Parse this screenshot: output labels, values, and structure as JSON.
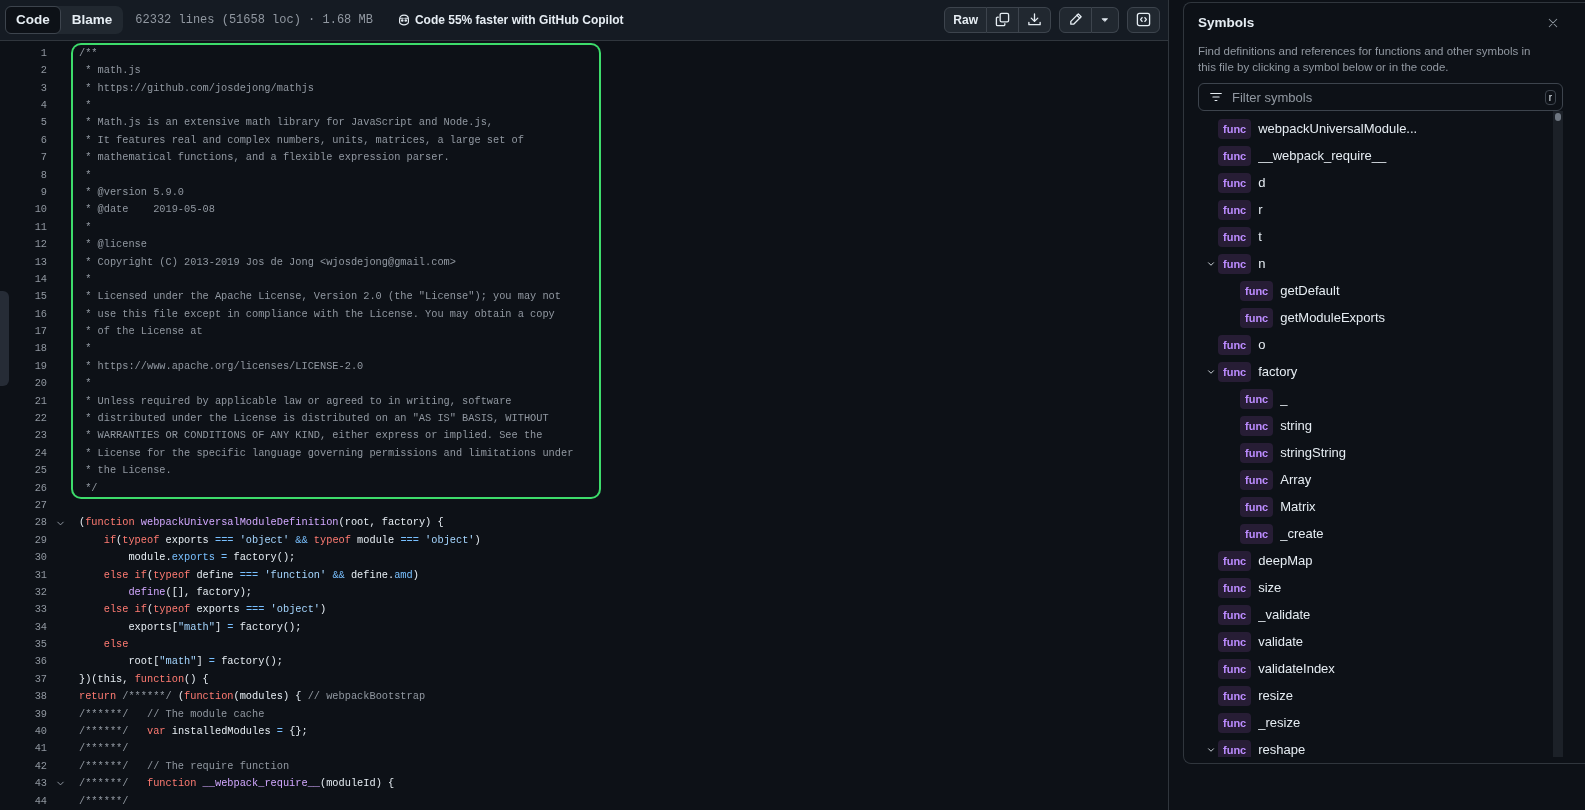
{
  "toolbar": {
    "tabs": [
      {
        "label": "Code",
        "selected": true
      },
      {
        "label": "Blame",
        "selected": false
      }
    ],
    "file_info": "62332 lines (51658 loc) · 1.68 MB",
    "copilot_promo": "Code 55% faster with GitHub Copilot",
    "raw_button": "Raw"
  },
  "code": {
    "blocks": [
      {
        "highlighted": true,
        "lines": [
          {
            "number": "1",
            "foldable": false,
            "tokens": [
              {
                "kind": "comment",
                "text": "/**"
              }
            ]
          },
          {
            "number": "2",
            "foldable": false,
            "tokens": [
              {
                "kind": "comment",
                "text": " * math.js"
              }
            ]
          },
          {
            "number": "3",
            "foldable": false,
            "tokens": [
              {
                "kind": "comment",
                "text": " * https://github.com/josdejong/mathjs"
              }
            ]
          },
          {
            "number": "4",
            "foldable": false,
            "tokens": [
              {
                "kind": "comment",
                "text": " *"
              }
            ]
          },
          {
            "number": "5",
            "foldable": false,
            "tokens": [
              {
                "kind": "comment",
                "text": " * Math.js is an extensive math library for JavaScript and Node.js,"
              }
            ]
          },
          {
            "number": "6",
            "foldable": false,
            "tokens": [
              {
                "kind": "comment",
                "text": " * It features real and complex numbers, units, matrices, a large set of"
              }
            ]
          },
          {
            "number": "7",
            "foldable": false,
            "tokens": [
              {
                "kind": "comment",
                "text": " * mathematical functions, and a flexible expression parser."
              }
            ]
          },
          {
            "number": "8",
            "foldable": false,
            "tokens": [
              {
                "kind": "comment",
                "text": " *"
              }
            ]
          },
          {
            "number": "9",
            "foldable": false,
            "tokens": [
              {
                "kind": "comment",
                "text": " * @version 5.9.0"
              }
            ]
          },
          {
            "number": "10",
            "foldable": false,
            "tokens": [
              {
                "kind": "comment",
                "text": " * @date    2019-05-08"
              }
            ]
          },
          {
            "number": "11",
            "foldable": false,
            "tokens": [
              {
                "kind": "comment",
                "text": " *"
              }
            ]
          },
          {
            "number": "12",
            "foldable": false,
            "tokens": [
              {
                "kind": "comment",
                "text": " * @license"
              }
            ]
          },
          {
            "number": "13",
            "foldable": false,
            "tokens": [
              {
                "kind": "comment",
                "text": " * Copyright (C) 2013-2019 Jos de Jong <wjosdejong@gmail.com>"
              }
            ]
          },
          {
            "number": "14",
            "foldable": false,
            "tokens": [
              {
                "kind": "comment",
                "text": " *"
              }
            ]
          },
          {
            "number": "15",
            "foldable": false,
            "tokens": [
              {
                "kind": "comment",
                "text": " * Licensed under the Apache License, Version 2.0 (the \"License\"); you may not"
              }
            ]
          },
          {
            "number": "16",
            "foldable": false,
            "tokens": [
              {
                "kind": "comment",
                "text": " * use this file except in compliance with the License. You may obtain a copy"
              }
            ]
          },
          {
            "number": "17",
            "foldable": false,
            "tokens": [
              {
                "kind": "comment",
                "text": " * of the License at"
              }
            ]
          },
          {
            "number": "18",
            "foldable": false,
            "tokens": [
              {
                "kind": "comment",
                "text": " *"
              }
            ]
          },
          {
            "number": "19",
            "foldable": false,
            "tokens": [
              {
                "kind": "comment",
                "text": " * https://www.apache.org/licenses/LICENSE-2.0"
              }
            ]
          },
          {
            "number": "20",
            "foldable": false,
            "tokens": [
              {
                "kind": "comment",
                "text": " *"
              }
            ]
          },
          {
            "number": "21",
            "foldable": false,
            "tokens": [
              {
                "kind": "comment",
                "text": " * Unless required by applicable law or agreed to in writing, software"
              }
            ]
          },
          {
            "number": "22",
            "foldable": false,
            "tokens": [
              {
                "kind": "comment",
                "text": " * distributed under the License is distributed on an \"AS IS\" BASIS, WITHOUT"
              }
            ]
          },
          {
            "number": "23",
            "foldable": false,
            "tokens": [
              {
                "kind": "comment",
                "text": " * WARRANTIES OR CONDITIONS OF ANY KIND, either express or implied. See the"
              }
            ]
          },
          {
            "number": "24",
            "foldable": false,
            "tokens": [
              {
                "kind": "comment",
                "text": " * License for the specific language governing permissions and limitations under"
              }
            ]
          },
          {
            "number": "25",
            "foldable": false,
            "tokens": [
              {
                "kind": "comment",
                "text": " * the License."
              }
            ]
          },
          {
            "number": "26",
            "foldable": false,
            "tokens": [
              {
                "kind": "comment",
                "text": " */"
              }
            ]
          }
        ]
      },
      {
        "highlighted": false,
        "lines": [
          {
            "number": "27",
            "foldable": false
          },
          {
            "number": "28",
            "foldable": true,
            "tokens": [
              {
                "kind": "plain",
                "text": "("
              },
              {
                "kind": "keyword",
                "text": "function "
              },
              {
                "kind": "entity",
                "text": "webpackUniversalModuleDefinition"
              },
              {
                "kind": "plain",
                "text": "(root, factory) {"
              }
            ]
          },
          {
            "number": "29",
            "foldable": false,
            "tokens": [
              {
                "kind": "keyword",
                "text": "    if"
              },
              {
                "kind": "plain",
                "text": "("
              },
              {
                "kind": "keyword",
                "text": "typeof"
              },
              {
                "kind": "plain",
                "text": " exports "
              },
              {
                "kind": "constant",
                "text": "=== "
              },
              {
                "kind": "string",
                "text": "'object' "
              },
              {
                "kind": "constant",
                "text": "&& "
              },
              {
                "kind": "keyword",
                "text": "typeof"
              },
              {
                "kind": "plain",
                "text": " module "
              },
              {
                "kind": "constant",
                "text": "=== "
              },
              {
                "kind": "string",
                "text": "'object'"
              },
              {
                "kind": "plain",
                "text": ")"
              }
            ]
          },
          {
            "number": "30",
            "foldable": false,
            "tokens": [
              {
                "kind": "plain",
                "text": "        module."
              },
              {
                "kind": "constant",
                "text": "exports ="
              },
              {
                "kind": "plain",
                "text": " factory();"
              }
            ]
          },
          {
            "number": "31",
            "foldable": false,
            "tokens": [
              {
                "kind": "keyword",
                "text": "    else if"
              },
              {
                "kind": "plain",
                "text": "("
              },
              {
                "kind": "keyword",
                "text": "typeof"
              },
              {
                "kind": "plain",
                "text": " define "
              },
              {
                "kind": "constant",
                "text": "=== "
              },
              {
                "kind": "string",
                "text": "'function' "
              },
              {
                "kind": "constant",
                "text": "&&"
              },
              {
                "kind": "plain",
                "text": " define."
              },
              {
                "kind": "constant",
                "text": "amd"
              },
              {
                "kind": "plain",
                "text": ")"
              }
            ]
          },
          {
            "number": "32",
            "foldable": false,
            "tokens": [
              {
                "kind": "entity",
                "text": "        define"
              },
              {
                "kind": "plain",
                "text": "([], factory);"
              }
            ]
          },
          {
            "number": "33",
            "foldable": false,
            "tokens": [
              {
                "kind": "keyword",
                "text": "    else if"
              },
              {
                "kind": "plain",
                "text": "("
              },
              {
                "kind": "keyword",
                "text": "typeof"
              },
              {
                "kind": "plain",
                "text": " exports "
              },
              {
                "kind": "constant",
                "text": "=== "
              },
              {
                "kind": "string",
                "text": "'object'"
              },
              {
                "kind": "plain",
                "text": ")"
              }
            ]
          },
          {
            "number": "34",
            "foldable": false,
            "tokens": [
              {
                "kind": "plain",
                "text": "        exports["
              },
              {
                "kind": "string",
                "text": "\"math\""
              },
              {
                "kind": "plain",
                "text": "] "
              },
              {
                "kind": "constant",
                "text": "="
              },
              {
                "kind": "plain",
                "text": " factory();"
              }
            ]
          },
          {
            "number": "35",
            "foldable": false,
            "tokens": [
              {
                "kind": "keyword",
                "text": "    else"
              }
            ]
          },
          {
            "number": "36",
            "foldable": false,
            "tokens": [
              {
                "kind": "plain",
                "text": "        root["
              },
              {
                "kind": "string",
                "text": "\"math\""
              },
              {
                "kind": "plain",
                "text": "] "
              },
              {
                "kind": "constant",
                "text": "="
              },
              {
                "kind": "plain",
                "text": " factory();"
              }
            ]
          },
          {
            "number": "37",
            "foldable": false,
            "tokens": [
              {
                "kind": "plain",
                "text": "})(this, "
              },
              {
                "kind": "keyword",
                "text": "function"
              },
              {
                "kind": "plain",
                "text": "() {"
              }
            ]
          },
          {
            "number": "38",
            "foldable": false,
            "tokens": [
              {
                "kind": "keyword",
                "text": "return "
              },
              {
                "kind": "comment",
                "text": "/******/"
              },
              {
                "kind": "plain",
                "text": " ("
              },
              {
                "kind": "keyword",
                "text": "function"
              },
              {
                "kind": "plain",
                "text": "(modules) { "
              },
              {
                "kind": "comment",
                "text": "// webpackBootstrap"
              }
            ]
          },
          {
            "number": "39",
            "foldable": false,
            "tokens": [
              {
                "kind": "comment",
                "text": "/******/   // The module cache"
              }
            ]
          },
          {
            "number": "40",
            "foldable": false,
            "tokens": [
              {
                "kind": "comment",
                "text": "/******/   "
              },
              {
                "kind": "keyword",
                "text": "var"
              },
              {
                "kind": "plain",
                "text": " installedModules "
              },
              {
                "kind": "constant",
                "text": "="
              },
              {
                "kind": "plain",
                "text": " {};"
              }
            ]
          },
          {
            "number": "41",
            "foldable": false,
            "tokens": [
              {
                "kind": "comment",
                "text": "/******/"
              }
            ]
          },
          {
            "number": "42",
            "foldable": false,
            "tokens": [
              {
                "kind": "comment",
                "text": "/******/   // The require function"
              }
            ]
          },
          {
            "number": "43",
            "foldable": true,
            "tokens": [
              {
                "kind": "comment",
                "text": "/******/   "
              },
              {
                "kind": "keyword",
                "text": "function "
              },
              {
                "kind": "entity",
                "text": "__webpack_require__"
              },
              {
                "kind": "plain",
                "text": "(moduleId) {"
              }
            ]
          },
          {
            "number": "44",
            "foldable": false,
            "tokens": [
              {
                "kind": "comment",
                "text": "/******/"
              }
            ]
          }
        ]
      }
    ]
  },
  "symbols_panel": {
    "title": "Symbols",
    "description": "Find definitions and references for functions and other symbols in this file by clicking a symbol below or in the code.",
    "filter": {
      "placeholder": "Filter symbols",
      "shortcut": "r"
    },
    "items": [
      {
        "kind_label": "func",
        "name": "webpackUniversalModule..."
      },
      {
        "kind_label": "func",
        "name": "__webpack_require__"
      },
      {
        "kind_label": "func",
        "name": "d"
      },
      {
        "kind_label": "func",
        "name": "r"
      },
      {
        "kind_label": "func",
        "name": "t"
      },
      {
        "kind_label": "func",
        "name": "n",
        "expanded": true,
        "children": [
          {
            "kind_label": "func",
            "name": "getDefault"
          },
          {
            "kind_label": "func",
            "name": "getModuleExports"
          }
        ]
      },
      {
        "kind_label": "func",
        "name": "o"
      },
      {
        "kind_label": "func",
        "name": "factory",
        "expanded": true,
        "children": [
          {
            "kind_label": "func",
            "name": "_"
          },
          {
            "kind_label": "func",
            "name": "string"
          },
          {
            "kind_label": "func",
            "name": "stringString"
          },
          {
            "kind_label": "func",
            "name": "Array"
          },
          {
            "kind_label": "func",
            "name": "Matrix"
          },
          {
            "kind_label": "func",
            "name": "_create"
          }
        ]
      },
      {
        "kind_label": "func",
        "name": "deepMap"
      },
      {
        "kind_label": "func",
        "name": "size"
      },
      {
        "kind_label": "func",
        "name": "_validate"
      },
      {
        "kind_label": "func",
        "name": "validate"
      },
      {
        "kind_label": "func",
        "name": "validateIndex"
      },
      {
        "kind_label": "func",
        "name": "resize"
      },
      {
        "kind_label": "func",
        "name": "_resize"
      },
      {
        "kind_label": "func",
        "name": "reshape",
        "expanded": true
      }
    ]
  }
}
